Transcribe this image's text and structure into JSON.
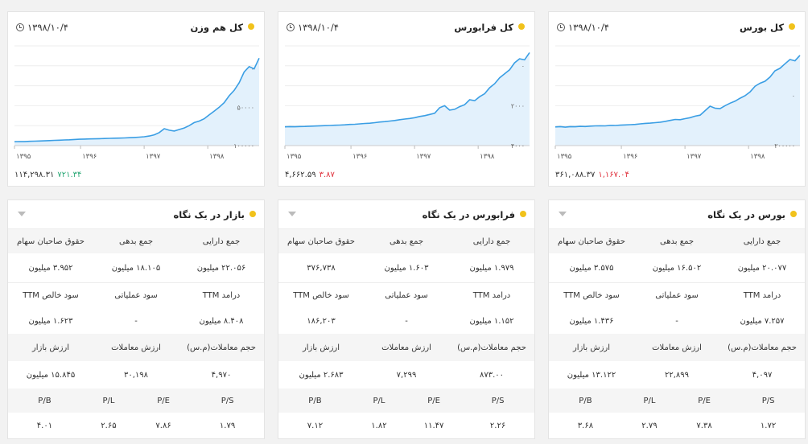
{
  "charts": [
    {
      "title": "کل بورس",
      "date": "۱۳۹۸/۱۰/۴",
      "value": "۳۶۱,۰۸۸.۳۷",
      "change": "۱,۱۶۷.۰۴",
      "change_dir": "neg",
      "y_ticks": [
        "۲۰۰۰۰۰",
        "۰"
      ],
      "x_ticks": [
        "۱۳۹۵",
        "۱۳۹۶",
        "۱۳۹۷",
        "۱۳۹۸"
      ]
    },
    {
      "title": "کل فرابورس",
      "date": "۱۳۹۸/۱۰/۴",
      "value": "۴,۶۶۲.۵۹",
      "change": "۳.۸۷",
      "change_dir": "neg",
      "y_ticks": [
        "۴۰۰۰",
        "۲۰۰۰",
        "۰"
      ],
      "x_ticks": [
        "۱۳۹۵",
        "۱۳۹۶",
        "۱۳۹۷",
        "۱۳۹۸"
      ]
    },
    {
      "title": "کل هم وزن",
      "date": "۱۳۹۸/۱۰/۴",
      "value": "۱۱۴,۲۹۸.۳۱",
      "change": "۷۲۱.۳۴",
      "change_dir": "pos",
      "y_ticks": [
        "۱۰۰۰۰۰",
        "۵۰۰۰۰",
        "۰"
      ],
      "x_ticks": [
        "۱۳۹۵",
        "۱۳۹۶",
        "۱۳۹۷",
        "۱۳۹۸"
      ]
    }
  ],
  "chart_data": [
    {
      "type": "area",
      "title": "کل بورس",
      "x_ticks": [
        "۱۳۹۵",
        "۱۳۹۶",
        "۱۳۹۷",
        "۱۳۹۸"
      ],
      "ylim": [
        0,
        400000
      ],
      "y_ticks": [
        0,
        200000
      ],
      "values": [
        75000,
        76000,
        74000,
        76000,
        75500,
        77000,
        76500,
        78000,
        79000,
        79500,
        79000,
        81000,
        80500,
        82000,
        83000,
        84000,
        85000,
        87000,
        89000,
        90000,
        92000,
        94000,
        97000,
        101000,
        105000,
        104000,
        108000,
        112000,
        118000,
        122000,
        140000,
        158000,
        150000,
        148000,
        160000,
        170000,
        178000,
        190000,
        200000,
        215000,
        238000,
        250000,
        258000,
        275000,
        300000,
        310000,
        328000,
        345000,
        340000,
        362000
      ]
    },
    {
      "type": "area",
      "title": "کل فرابورس",
      "x_ticks": [
        "۱۳۹۵",
        "۱۳۹۶",
        "۱۳۹۷",
        "۱۳۹۸"
      ],
      "ylim": [
        0,
        5000
      ],
      "y_ticks": [
        0,
        2000,
        4000
      ],
      "values": [
        940,
        950,
        945,
        955,
        960,
        970,
        980,
        990,
        1000,
        1010,
        1020,
        1030,
        1040,
        1060,
        1070,
        1090,
        1110,
        1120,
        1150,
        1180,
        1200,
        1230,
        1260,
        1300,
        1330,
        1360,
        1400,
        1460,
        1500,
        1560,
        1620,
        1900,
        2000,
        1780,
        1820,
        1950,
        2050,
        2300,
        2250,
        2450,
        2600,
        2900,
        3100,
        3400,
        3600,
        3800,
        4150,
        4350,
        4300,
        4660
      ]
    },
    {
      "type": "area",
      "title": "کل هم وزن",
      "x_ticks": [
        "۱۳۹۵",
        "۱۳۹۶",
        "۱۳۹۷",
        "۱۳۹۸"
      ],
      "ylim": [
        0,
        130000
      ],
      "y_ticks": [
        0,
        50000,
        100000
      ],
      "values": [
        5000,
        5200,
        5100,
        5600,
        5800,
        6000,
        6200,
        6500,
        6800,
        7000,
        7300,
        7600,
        8000,
        8300,
        8500,
        8700,
        8800,
        9000,
        9200,
        9400,
        9600,
        9800,
        10000,
        10300,
        10600,
        11000,
        11500,
        12500,
        14000,
        17000,
        22000,
        20000,
        19000,
        21000,
        23000,
        26000,
        30000,
        32000,
        35000,
        40000,
        45000,
        50000,
        56000,
        65000,
        72000,
        82000,
        96000,
        103000,
        100000,
        114000
      ]
    }
  ],
  "tables": [
    {
      "title": "بورس در یک نگاه",
      "headers1": [
        "جمع دارایی",
        "جمع بدهی",
        "حقوق صاحبان سهام"
      ],
      "values1": [
        "۲۰.۰۷۷ میلیون",
        "۱۶.۵۰۲ میلیون",
        "۳.۵۷۵ میلیون"
      ],
      "headers2": [
        "درآمد TTM",
        "سود عملیاتی",
        "سود خالص TTM"
      ],
      "values2": [
        "۷.۲۵۷ میلیون",
        "-",
        "۱.۴۳۶ میلیون"
      ],
      "headers3": [
        "حجم معاملات(م.س)",
        "ارزش معاملات",
        "ارزش بازار"
      ],
      "values3": [
        "۴,۰۹۷",
        "۲۲,۸۹۹",
        "۱۳.۱۲۲ میلیون"
      ],
      "headers4": [
        "P/S",
        "P/E",
        "P/L",
        "P/B"
      ],
      "values4": [
        "۱.۷۲",
        "۷.۳۸",
        "۲.۷۹",
        "۳.۶۸"
      ]
    },
    {
      "title": "فرابورس در یک نگاه",
      "headers1": [
        "جمع دارایی",
        "جمع بدهی",
        "حقوق صاحبان سهام"
      ],
      "values1": [
        "۱.۹۷۹ میلیون",
        "۱.۶۰۳ میلیون",
        "۳۷۶,۷۳۸"
      ],
      "headers2": [
        "درآمد TTM",
        "سود عملیاتی",
        "سود خالص TTM"
      ],
      "values2": [
        "۱.۱۵۲ میلیون",
        "-",
        "۱۸۶,۲۰۳"
      ],
      "headers3": [
        "حجم معاملات(م.س)",
        "ارزش معاملات",
        "ارزش بازار"
      ],
      "values3": [
        "۸۷۳.۰۰",
        "۷,۲۹۹",
        "۲.۶۸۳ میلیون"
      ],
      "headers4": [
        "P/S",
        "P/E",
        "P/L",
        "P/B"
      ],
      "values4": [
        "۲.۲۶",
        "۱۱.۴۷",
        "۱.۸۲",
        "۷.۱۲"
      ]
    },
    {
      "title": "بازار در یک نگاه",
      "headers1": [
        "جمع دارایی",
        "جمع بدهی",
        "حقوق صاحبان سهام"
      ],
      "values1": [
        "۲۲.۰۵۶ میلیون",
        "۱۸.۱۰۵ میلیون",
        "۳.۹۵۲ میلیون"
      ],
      "headers2": [
        "درآمد TTM",
        "سود عملیاتی",
        "سود خالص TTM"
      ],
      "values2": [
        "۸.۴۰۸ میلیون",
        "-",
        "۱.۶۲۳ میلیون"
      ],
      "headers3": [
        "حجم معاملات(م.س)",
        "ارزش معاملات",
        "ارزش بازار"
      ],
      "values3": [
        "۴,۹۷۰",
        "۳۰,۱۹۸",
        "۱۵.۸۴۵ میلیون"
      ],
      "headers4": [
        "P/S",
        "P/E",
        "P/L",
        "P/B"
      ],
      "values4": [
        "۱.۷۹",
        "۷.۸۶",
        "۲.۶۵",
        "۴.۰۱"
      ]
    }
  ],
  "colors": {
    "line": "#3a9ee4",
    "fill": "#e3f1fc",
    "grid": "#eeeeee",
    "dot": "#f1c21b",
    "positive": "#2aa876",
    "negative": "#e0333e"
  }
}
